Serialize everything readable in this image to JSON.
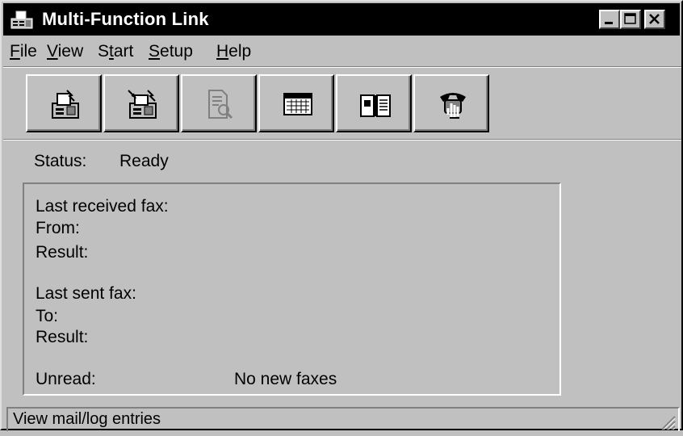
{
  "window": {
    "title": "Multi-Function Link",
    "icon": "fax-app-icon"
  },
  "title_buttons": {
    "minimize": "minimize-icon",
    "maximize": "maximize-icon",
    "close": "close-icon"
  },
  "menu": {
    "items": [
      {
        "pre": "",
        "u": "F",
        "post": "ile"
      },
      {
        "pre": "",
        "u": "V",
        "post": "iew"
      },
      {
        "pre": "S",
        "u": "t",
        "post": "art"
      },
      {
        "pre": "",
        "u": "S",
        "post": "etup"
      },
      {
        "pre": "",
        "u": "H",
        "post": "elp"
      }
    ]
  },
  "toolbar": {
    "buttons": [
      {
        "icon": "send-fax-icon",
        "enabled": true
      },
      {
        "icon": "receive-fax-icon",
        "enabled": true
      },
      {
        "icon": "view-document-icon",
        "enabled": false
      },
      {
        "icon": "schedule-icon",
        "enabled": true
      },
      {
        "icon": "phonebook-icon",
        "enabled": true
      },
      {
        "icon": "phone-dial-icon",
        "enabled": true
      }
    ]
  },
  "status": {
    "label": "Status:",
    "value": "Ready"
  },
  "info": {
    "last_received": "Last received fax:",
    "from": "From:",
    "result1": "Result:",
    "last_sent": "Last sent fax:",
    "to": "To:",
    "result2": "Result:",
    "unread_label": "Unread:",
    "unread_value": "No new faxes"
  },
  "statusbar": {
    "text": "View mail/log entries"
  },
  "colors": {
    "face": "#c0c0c0",
    "titlebar": "#000000",
    "highlight": "#ffffff",
    "shadow": "#808080"
  }
}
